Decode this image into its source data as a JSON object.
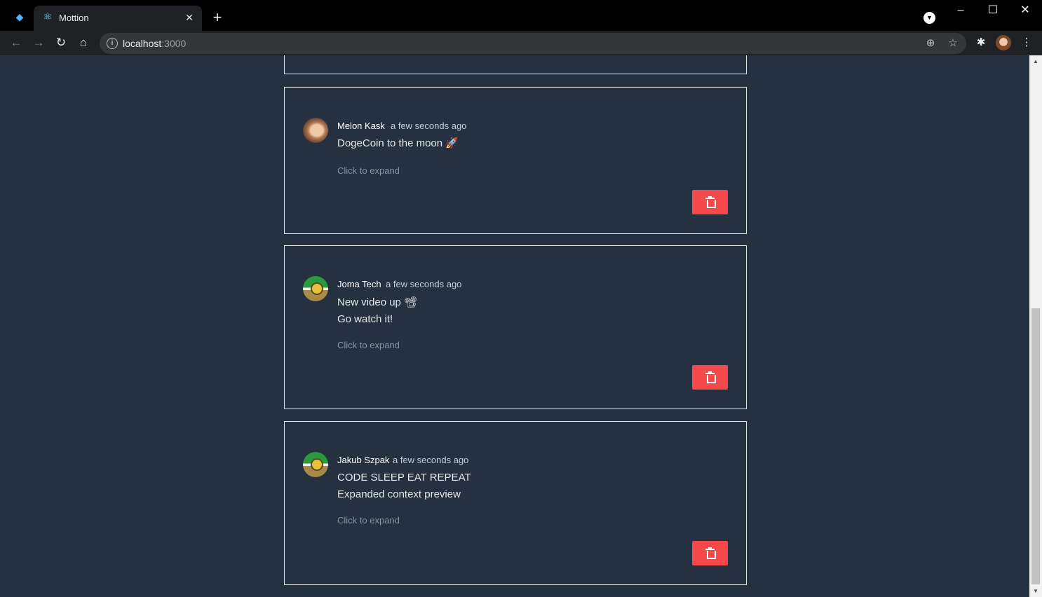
{
  "browser": {
    "tab_title": "Mottion",
    "url_host": "localhost",
    "url_port": ":3000",
    "icons": [
      "gem-extension-icon",
      "react-favicon-icon",
      "close-tab-icon",
      "new-tab-icon",
      "back-icon",
      "forward-icon",
      "reload-icon",
      "home-icon",
      "site-info-icon",
      "zoom-icon",
      "bookmark-star-icon",
      "extensions-icon",
      "profile-avatar",
      "menu-kebab-icon"
    ]
  },
  "posts": [
    {
      "author": "Melon Kask",
      "time": "a few seconds ago",
      "lines": [
        "DogeCoin to the moon 🚀"
      ],
      "expand_label": "Click to expand",
      "avatar": "melon"
    },
    {
      "author": "Joma Tech",
      "time": "a few seconds ago",
      "lines": [
        "New video up 📽",
        "Go watch it!"
      ],
      "expand_label": "Click to expand",
      "avatar": "green"
    },
    {
      "author": "Jakub Szpak",
      "time": "a few seconds ago",
      "lines": [
        "CODE SLEEP EAT REPEAT",
        "Expanded context preview"
      ],
      "expand_label": "Click to expand",
      "avatar": "green"
    }
  ],
  "colors": {
    "page_bg": "#253040",
    "card_border": "#e6e6e6",
    "delete_button": "#f4484b"
  }
}
